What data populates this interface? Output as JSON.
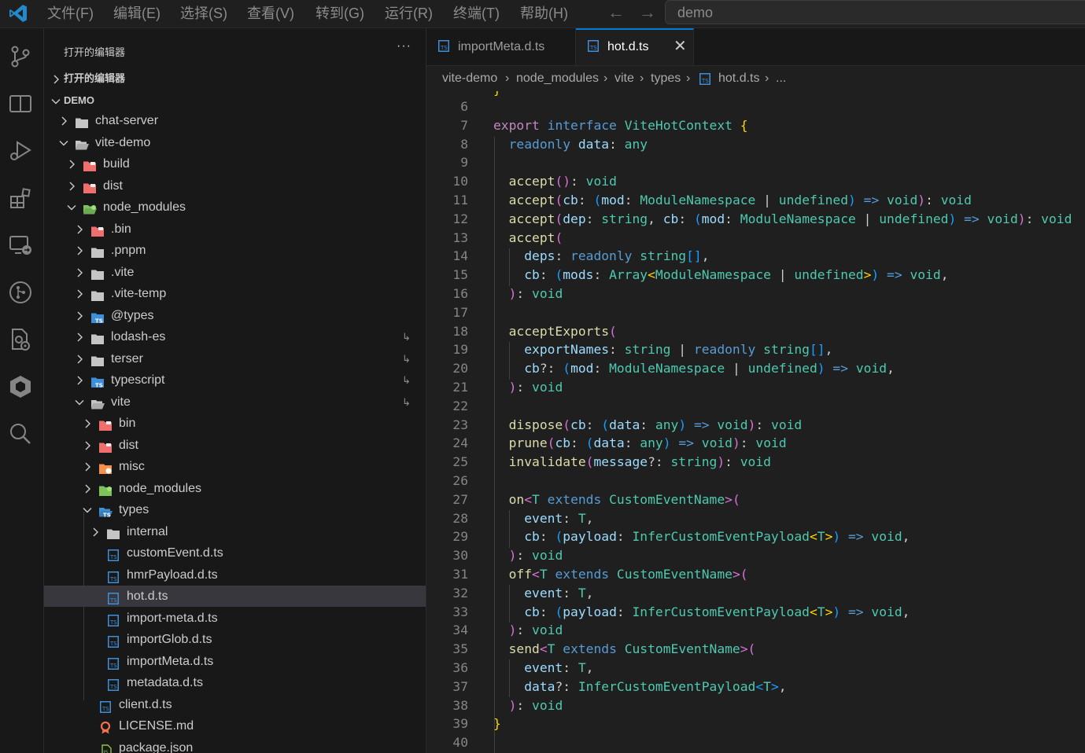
{
  "titlebar": {
    "menus": [
      "文件(F)",
      "编辑(E)",
      "选择(S)",
      "查看(V)",
      "转到(G)",
      "运行(R)",
      "终端(T)",
      "帮助(H)"
    ],
    "search_text": "demo"
  },
  "activity_bar": [
    "source-control-icon",
    "split-editor-icon",
    "run-debug-icon",
    "extensions-icon",
    "remote-explorer-icon",
    "git-graph-icon",
    "settings-sync-icon",
    "cube-icon",
    "search-icon"
  ],
  "sidebar": {
    "header": "打开的编辑器",
    "more": "···",
    "open_editors_label": "打开的编辑器",
    "workspace_label": "DEMO",
    "tree": [
      {
        "name": "chat-server",
        "depth": 0,
        "kind": "folder",
        "open": false
      },
      {
        "name": "vite-demo",
        "depth": 0,
        "kind": "folder",
        "open": true
      },
      {
        "name": "build",
        "depth": 1,
        "kind": "folder-red",
        "open": false
      },
      {
        "name": "dist",
        "depth": 1,
        "kind": "folder-red",
        "open": false
      },
      {
        "name": "node_modules",
        "depth": 1,
        "kind": "folder-green",
        "open": true
      },
      {
        "name": ".bin",
        "depth": 2,
        "kind": "folder-red",
        "open": false
      },
      {
        "name": ".pnpm",
        "depth": 2,
        "kind": "folder",
        "open": false
      },
      {
        "name": ".vite",
        "depth": 2,
        "kind": "folder",
        "open": false
      },
      {
        "name": ".vite-temp",
        "depth": 2,
        "kind": "folder",
        "open": false
      },
      {
        "name": "@types",
        "depth": 2,
        "kind": "folder-ts",
        "open": false
      },
      {
        "name": "lodash-es",
        "depth": 2,
        "kind": "folder",
        "open": false,
        "link": true
      },
      {
        "name": "terser",
        "depth": 2,
        "kind": "folder",
        "open": false,
        "link": true
      },
      {
        "name": "typescript",
        "depth": 2,
        "kind": "folder-ts",
        "open": false,
        "link": true
      },
      {
        "name": "vite",
        "depth": 2,
        "kind": "folder",
        "open": true,
        "link": true
      },
      {
        "name": "bin",
        "depth": 3,
        "kind": "folder-red",
        "open": false
      },
      {
        "name": "dist",
        "depth": 3,
        "kind": "folder-red",
        "open": false
      },
      {
        "name": "misc",
        "depth": 3,
        "kind": "folder-orange",
        "open": false
      },
      {
        "name": "node_modules",
        "depth": 3,
        "kind": "folder-green",
        "open": false
      },
      {
        "name": "types",
        "depth": 3,
        "kind": "folder-ts",
        "open": true
      },
      {
        "name": "internal",
        "depth": 4,
        "kind": "folder",
        "open": false
      },
      {
        "name": "customEvent.d.ts",
        "depth": 4,
        "kind": "ts"
      },
      {
        "name": "hmrPayload.d.ts",
        "depth": 4,
        "kind": "ts"
      },
      {
        "name": "hot.d.ts",
        "depth": 4,
        "kind": "ts",
        "selected": true
      },
      {
        "name": "import-meta.d.ts",
        "depth": 4,
        "kind": "ts"
      },
      {
        "name": "importGlob.d.ts",
        "depth": 4,
        "kind": "ts"
      },
      {
        "name": "importMeta.d.ts",
        "depth": 4,
        "kind": "ts"
      },
      {
        "name": "metadata.d.ts",
        "depth": 4,
        "kind": "ts"
      },
      {
        "name": "client.d.ts",
        "depth": 3,
        "kind": "ts"
      },
      {
        "name": "LICENSE.md",
        "depth": 3,
        "kind": "license"
      },
      {
        "name": "package.json",
        "depth": 3,
        "kind": "json"
      }
    ]
  },
  "tabs": [
    {
      "label": "importMeta.d.ts",
      "active": false
    },
    {
      "label": "hot.d.ts",
      "active": true
    }
  ],
  "breadcrumb": [
    "vite-demo",
    "node_modules",
    "vite",
    "types",
    "hot.d.ts",
    "..."
  ],
  "code": {
    "first_line": 6,
    "lines": [
      [],
      [
        [
          "c",
          "export"
        ],
        [
          "p",
          " "
        ],
        [
          "k",
          "interface"
        ],
        [
          "p",
          " "
        ],
        [
          "ty",
          "ViteHotContext"
        ],
        [
          "p",
          " "
        ],
        [
          "br1",
          "{"
        ]
      ],
      [
        [
          "p",
          "  "
        ],
        [
          "k",
          "readonly"
        ],
        [
          "p",
          " "
        ],
        [
          "v",
          "data"
        ],
        [
          "p",
          ": "
        ],
        [
          "ty",
          "any"
        ]
      ],
      [],
      [
        [
          "p",
          "  "
        ],
        [
          "f",
          "accept"
        ],
        [
          "br2",
          "()"
        ],
        [
          "p",
          ": "
        ],
        [
          "ty",
          "void"
        ]
      ],
      [
        [
          "p",
          "  "
        ],
        [
          "f",
          "accept"
        ],
        [
          "br2",
          "("
        ],
        [
          "v",
          "cb"
        ],
        [
          "p",
          ": "
        ],
        [
          "br3",
          "("
        ],
        [
          "v",
          "mod"
        ],
        [
          "p",
          ": "
        ],
        [
          "ty",
          "ModuleNamespace"
        ],
        [
          "p",
          " | "
        ],
        [
          "ty",
          "undefined"
        ],
        [
          "br3",
          ")"
        ],
        [
          "p",
          " "
        ],
        [
          "k",
          "=>"
        ],
        [
          "p",
          " "
        ],
        [
          "ty",
          "void"
        ],
        [
          "br2",
          ")"
        ],
        [
          "p",
          ": "
        ],
        [
          "ty",
          "void"
        ]
      ],
      [
        [
          "p",
          "  "
        ],
        [
          "f",
          "accept"
        ],
        [
          "br2",
          "("
        ],
        [
          "v",
          "dep"
        ],
        [
          "p",
          ": "
        ],
        [
          "ty",
          "string"
        ],
        [
          "p",
          ", "
        ],
        [
          "v",
          "cb"
        ],
        [
          "p",
          ": "
        ],
        [
          "br3",
          "("
        ],
        [
          "v",
          "mod"
        ],
        [
          "p",
          ": "
        ],
        [
          "ty",
          "ModuleNamespace"
        ],
        [
          "p",
          " | "
        ],
        [
          "ty",
          "undefined"
        ],
        [
          "br3",
          ")"
        ],
        [
          "p",
          " "
        ],
        [
          "k",
          "=>"
        ],
        [
          "p",
          " "
        ],
        [
          "ty",
          "void"
        ],
        [
          "br2",
          ")"
        ],
        [
          "p",
          ": "
        ],
        [
          "ty",
          "void"
        ]
      ],
      [
        [
          "p",
          "  "
        ],
        [
          "f",
          "accept"
        ],
        [
          "br2",
          "("
        ]
      ],
      [
        [
          "p",
          "    "
        ],
        [
          "v",
          "deps"
        ],
        [
          "p",
          ": "
        ],
        [
          "k",
          "readonly"
        ],
        [
          "p",
          " "
        ],
        [
          "ty",
          "string"
        ],
        [
          "br3",
          "[]"
        ],
        [
          "p",
          ","
        ]
      ],
      [
        [
          "p",
          "    "
        ],
        [
          "v",
          "cb"
        ],
        [
          "p",
          ": "
        ],
        [
          "br3",
          "("
        ],
        [
          "v",
          "mods"
        ],
        [
          "p",
          ": "
        ],
        [
          "ty",
          "Array"
        ],
        [
          "br1",
          "<"
        ],
        [
          "ty",
          "ModuleNamespace"
        ],
        [
          "p",
          " | "
        ],
        [
          "ty",
          "undefined"
        ],
        [
          "br1",
          ">"
        ],
        [
          "br3",
          ")"
        ],
        [
          "p",
          " "
        ],
        [
          "k",
          "=>"
        ],
        [
          "p",
          " "
        ],
        [
          "ty",
          "void"
        ],
        [
          "p",
          ","
        ]
      ],
      [
        [
          "p",
          "  "
        ],
        [
          "br2",
          ")"
        ],
        [
          "p",
          ": "
        ],
        [
          "ty",
          "void"
        ]
      ],
      [],
      [
        [
          "p",
          "  "
        ],
        [
          "f",
          "acceptExports"
        ],
        [
          "br2",
          "("
        ]
      ],
      [
        [
          "p",
          "    "
        ],
        [
          "v",
          "exportNames"
        ],
        [
          "p",
          ": "
        ],
        [
          "ty",
          "string"
        ],
        [
          "p",
          " | "
        ],
        [
          "k",
          "readonly"
        ],
        [
          "p",
          " "
        ],
        [
          "ty",
          "string"
        ],
        [
          "br3",
          "[]"
        ],
        [
          "p",
          ","
        ]
      ],
      [
        [
          "p",
          "    "
        ],
        [
          "v",
          "cb"
        ],
        [
          "p",
          "?: "
        ],
        [
          "br3",
          "("
        ],
        [
          "v",
          "mod"
        ],
        [
          "p",
          ": "
        ],
        [
          "ty",
          "ModuleNamespace"
        ],
        [
          "p",
          " | "
        ],
        [
          "ty",
          "undefined"
        ],
        [
          "br3",
          ")"
        ],
        [
          "p",
          " "
        ],
        [
          "k",
          "=>"
        ],
        [
          "p",
          " "
        ],
        [
          "ty",
          "void"
        ],
        [
          "p",
          ","
        ]
      ],
      [
        [
          "p",
          "  "
        ],
        [
          "br2",
          ")"
        ],
        [
          "p",
          ": "
        ],
        [
          "ty",
          "void"
        ]
      ],
      [],
      [
        [
          "p",
          "  "
        ],
        [
          "f",
          "dispose"
        ],
        [
          "br2",
          "("
        ],
        [
          "v",
          "cb"
        ],
        [
          "p",
          ": "
        ],
        [
          "br3",
          "("
        ],
        [
          "v",
          "data"
        ],
        [
          "p",
          ": "
        ],
        [
          "ty",
          "any"
        ],
        [
          "br3",
          ")"
        ],
        [
          "p",
          " "
        ],
        [
          "k",
          "=>"
        ],
        [
          "p",
          " "
        ],
        [
          "ty",
          "void"
        ],
        [
          "br2",
          ")"
        ],
        [
          "p",
          ": "
        ],
        [
          "ty",
          "void"
        ]
      ],
      [
        [
          "p",
          "  "
        ],
        [
          "f",
          "prune"
        ],
        [
          "br2",
          "("
        ],
        [
          "v",
          "cb"
        ],
        [
          "p",
          ": "
        ],
        [
          "br3",
          "("
        ],
        [
          "v",
          "data"
        ],
        [
          "p",
          ": "
        ],
        [
          "ty",
          "any"
        ],
        [
          "br3",
          ")"
        ],
        [
          "p",
          " "
        ],
        [
          "k",
          "=>"
        ],
        [
          "p",
          " "
        ],
        [
          "ty",
          "void"
        ],
        [
          "br2",
          ")"
        ],
        [
          "p",
          ": "
        ],
        [
          "ty",
          "void"
        ]
      ],
      [
        [
          "p",
          "  "
        ],
        [
          "f",
          "invalidate"
        ],
        [
          "br2",
          "("
        ],
        [
          "v",
          "message"
        ],
        [
          "p",
          "?: "
        ],
        [
          "ty",
          "string"
        ],
        [
          "br2",
          ")"
        ],
        [
          "p",
          ": "
        ],
        [
          "ty",
          "void"
        ]
      ],
      [],
      [
        [
          "p",
          "  "
        ],
        [
          "f",
          "on"
        ],
        [
          "br2",
          "<"
        ],
        [
          "ty",
          "T"
        ],
        [
          "p",
          " "
        ],
        [
          "k",
          "extends"
        ],
        [
          "p",
          " "
        ],
        [
          "ty",
          "CustomEventName"
        ],
        [
          "br2",
          ">("
        ]
      ],
      [
        [
          "p",
          "    "
        ],
        [
          "v",
          "event"
        ],
        [
          "p",
          ": "
        ],
        [
          "ty",
          "T"
        ],
        [
          "p",
          ","
        ]
      ],
      [
        [
          "p",
          "    "
        ],
        [
          "v",
          "cb"
        ],
        [
          "p",
          ": "
        ],
        [
          "br3",
          "("
        ],
        [
          "v",
          "payload"
        ],
        [
          "p",
          ": "
        ],
        [
          "ty",
          "InferCustomEventPayload"
        ],
        [
          "br1",
          "<"
        ],
        [
          "ty",
          "T"
        ],
        [
          "br1",
          ">"
        ],
        [
          "br3",
          ")"
        ],
        [
          "p",
          " "
        ],
        [
          "k",
          "=>"
        ],
        [
          "p",
          " "
        ],
        [
          "ty",
          "void"
        ],
        [
          "p",
          ","
        ]
      ],
      [
        [
          "p",
          "  "
        ],
        [
          "br2",
          ")"
        ],
        [
          "p",
          ": "
        ],
        [
          "ty",
          "void"
        ]
      ],
      [
        [
          "p",
          "  "
        ],
        [
          "f",
          "off"
        ],
        [
          "br2",
          "<"
        ],
        [
          "ty",
          "T"
        ],
        [
          "p",
          " "
        ],
        [
          "k",
          "extends"
        ],
        [
          "p",
          " "
        ],
        [
          "ty",
          "CustomEventName"
        ],
        [
          "br2",
          ">("
        ]
      ],
      [
        [
          "p",
          "    "
        ],
        [
          "v",
          "event"
        ],
        [
          "p",
          ": "
        ],
        [
          "ty",
          "T"
        ],
        [
          "p",
          ","
        ]
      ],
      [
        [
          "p",
          "    "
        ],
        [
          "v",
          "cb"
        ],
        [
          "p",
          ": "
        ],
        [
          "br3",
          "("
        ],
        [
          "v",
          "payload"
        ],
        [
          "p",
          ": "
        ],
        [
          "ty",
          "InferCustomEventPayload"
        ],
        [
          "br1",
          "<"
        ],
        [
          "ty",
          "T"
        ],
        [
          "br1",
          ">"
        ],
        [
          "br3",
          ")"
        ],
        [
          "p",
          " "
        ],
        [
          "k",
          "=>"
        ],
        [
          "p",
          " "
        ],
        [
          "ty",
          "void"
        ],
        [
          "p",
          ","
        ]
      ],
      [
        [
          "p",
          "  "
        ],
        [
          "br2",
          ")"
        ],
        [
          "p",
          ": "
        ],
        [
          "ty",
          "void"
        ]
      ],
      [
        [
          "p",
          "  "
        ],
        [
          "f",
          "send"
        ],
        [
          "br2",
          "<"
        ],
        [
          "ty",
          "T"
        ],
        [
          "p",
          " "
        ],
        [
          "k",
          "extends"
        ],
        [
          "p",
          " "
        ],
        [
          "ty",
          "CustomEventName"
        ],
        [
          "br2",
          ">("
        ]
      ],
      [
        [
          "p",
          "    "
        ],
        [
          "v",
          "event"
        ],
        [
          "p",
          ": "
        ],
        [
          "ty",
          "T"
        ],
        [
          "p",
          ","
        ]
      ],
      [
        [
          "p",
          "    "
        ],
        [
          "v",
          "data"
        ],
        [
          "p",
          "?: "
        ],
        [
          "ty",
          "InferCustomEventPayload"
        ],
        [
          "br3",
          "<"
        ],
        [
          "ty",
          "T"
        ],
        [
          "br3",
          ">"
        ],
        [
          "p",
          ","
        ]
      ],
      [
        [
          "p",
          "  "
        ],
        [
          "br2",
          ")"
        ],
        [
          "p",
          ": "
        ],
        [
          "ty",
          "void"
        ]
      ],
      [
        [
          "br1",
          "}"
        ]
      ],
      []
    ]
  }
}
